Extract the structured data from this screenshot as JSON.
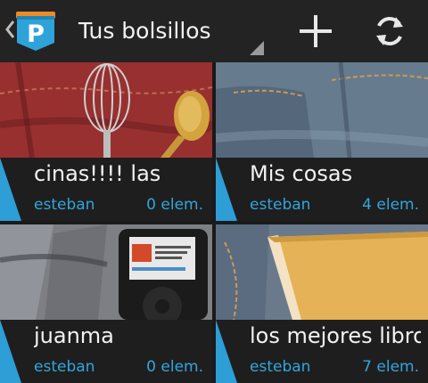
{
  "header": {
    "title": "Tus bolsillos",
    "app_logo_letter": "P",
    "actions": {
      "add": "add-icon",
      "refresh": "refresh-icon"
    }
  },
  "pockets": [
    {
      "name": "cinas!!!!   las",
      "owner": "esteban",
      "count": "0 elem.",
      "photo": "jeans-with-whisk-and-spoon"
    },
    {
      "name": "Mis cosas",
      "owner": "esteban",
      "count": "4 elem.",
      "photo": "jeans-back-pocket"
    },
    {
      "name": "juanma",
      "owner": "esteban",
      "count": "0 elem.",
      "photo": "ipod-in-pocket"
    },
    {
      "name": "los mejores libros",
      "owner": "esteban",
      "count": "7 elem.",
      "photo": "book-on-jeans"
    }
  ],
  "colors": {
    "accent": "#2d9ed6",
    "link_text": "#31a6dd",
    "bar_bg": "#232323",
    "card_bg": "#1e1e1e"
  }
}
